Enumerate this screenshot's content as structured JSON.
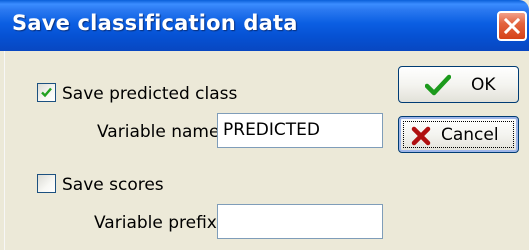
{
  "window": {
    "title": "Save classification data",
    "close_icon": "close-icon"
  },
  "predicted": {
    "checkbox_label": "Save predicted class",
    "checked": true,
    "variable_label": "Variable name:",
    "variable_value": "PREDICTED"
  },
  "scores": {
    "checkbox_label": "Save scores",
    "checked": false,
    "prefix_label": "Variable prefix:",
    "prefix_value": ""
  },
  "buttons": {
    "ok_label": "OK",
    "ok_icon": "checkmark-icon",
    "cancel_label": "Cancel",
    "cancel_icon": "x-icon"
  },
  "colors": {
    "titlebar": "#0b5fe3",
    "ok_check": "#1c9a1c",
    "cancel_x": "#b01010"
  }
}
